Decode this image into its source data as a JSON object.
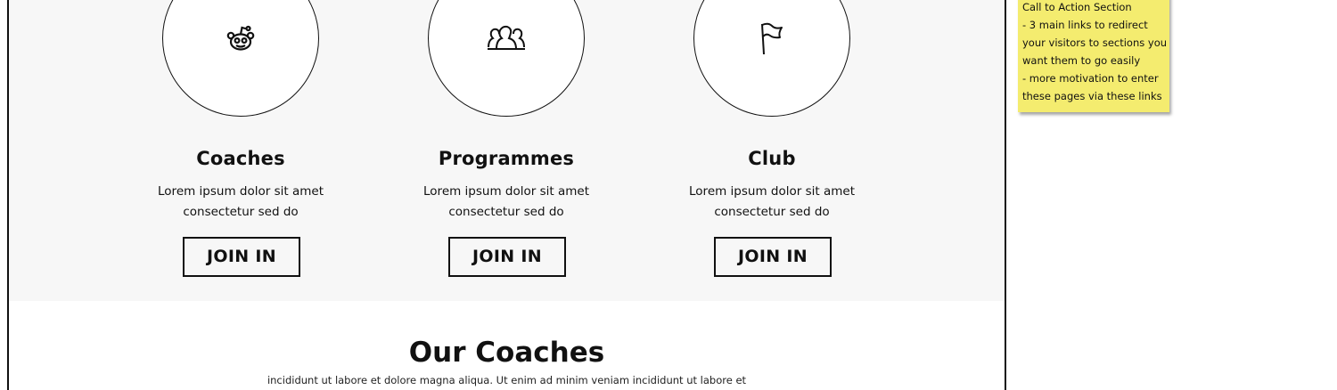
{
  "cta": {
    "cards": [
      {
        "title": "Coaches",
        "desc_line1": "Lorem ipsum dolor sit amet",
        "desc_line2": "consectetur sed do",
        "button": "JOIN IN",
        "icon": "reddit-alien-icon"
      },
      {
        "title": "Programmes",
        "desc_line1": "Lorem ipsum dolor sit amet",
        "desc_line2": "consectetur sed do",
        "button": "JOIN IN",
        "icon": "group-icon"
      },
      {
        "title": "Club",
        "desc_line1": "Lorem ipsum dolor sit amet",
        "desc_line2": "consectetur sed do",
        "button": "JOIN IN",
        "icon": "flag-icon"
      }
    ]
  },
  "coaches_section": {
    "title": "Our Coaches",
    "text": "incididunt ut labore et dolore magna aliqua. Ut enim ad minim veniam incididunt ut labore et"
  },
  "sticky_note": {
    "lines": [
      "Call to Action Section",
      "- 3 main links to redirect",
      "your visitors to sections you",
      "want them to go easily",
      "- more motivation to enter",
      "these pages via these links"
    ]
  },
  "colors": {
    "band_background": "#f7f7f7",
    "note_yellow": "#f4ec6f",
    "border": "#111111"
  }
}
